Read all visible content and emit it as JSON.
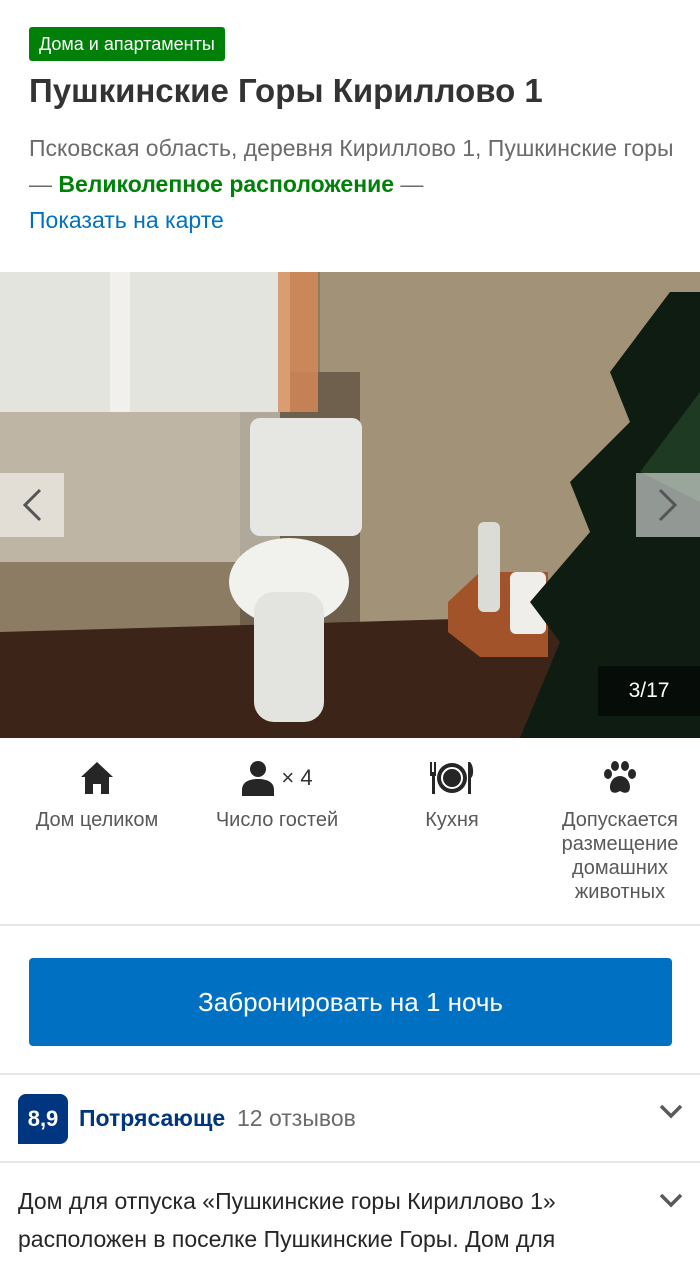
{
  "badge": "Дома и апартаменты",
  "title": "Пушкинские Горы Кириллово 1",
  "address": {
    "text": "Псковская область, деревня Кириллово 1, Пушкинские горы",
    "sep": " — ",
    "highlight": "Великолепное расположение",
    "sep2": " —",
    "map_link": "Показать на карте"
  },
  "gallery": {
    "counter": "3/17"
  },
  "features": [
    {
      "icon": "house-icon",
      "label": "Дом целиком"
    },
    {
      "icon": "person-icon",
      "label": "Число гостей",
      "extra": "× 4"
    },
    {
      "icon": "plate-cutlery-icon",
      "label": "Кухня"
    },
    {
      "icon": "paw-icon",
      "label": "Допускается размещение домашних животных"
    }
  ],
  "booking": {
    "label": "Забронировать на 1 ночь"
  },
  "rating": {
    "score": "8,9",
    "word": "Потрясающе",
    "reviews": "12 отзывов"
  },
  "description": "Дом для отпуска «Пушкинские горы Кириллово 1» расположен в поселке Пушкинские Горы. Дом для",
  "colors": {
    "accent": "#0071c2",
    "brand": "#003580",
    "good": "#008009"
  }
}
